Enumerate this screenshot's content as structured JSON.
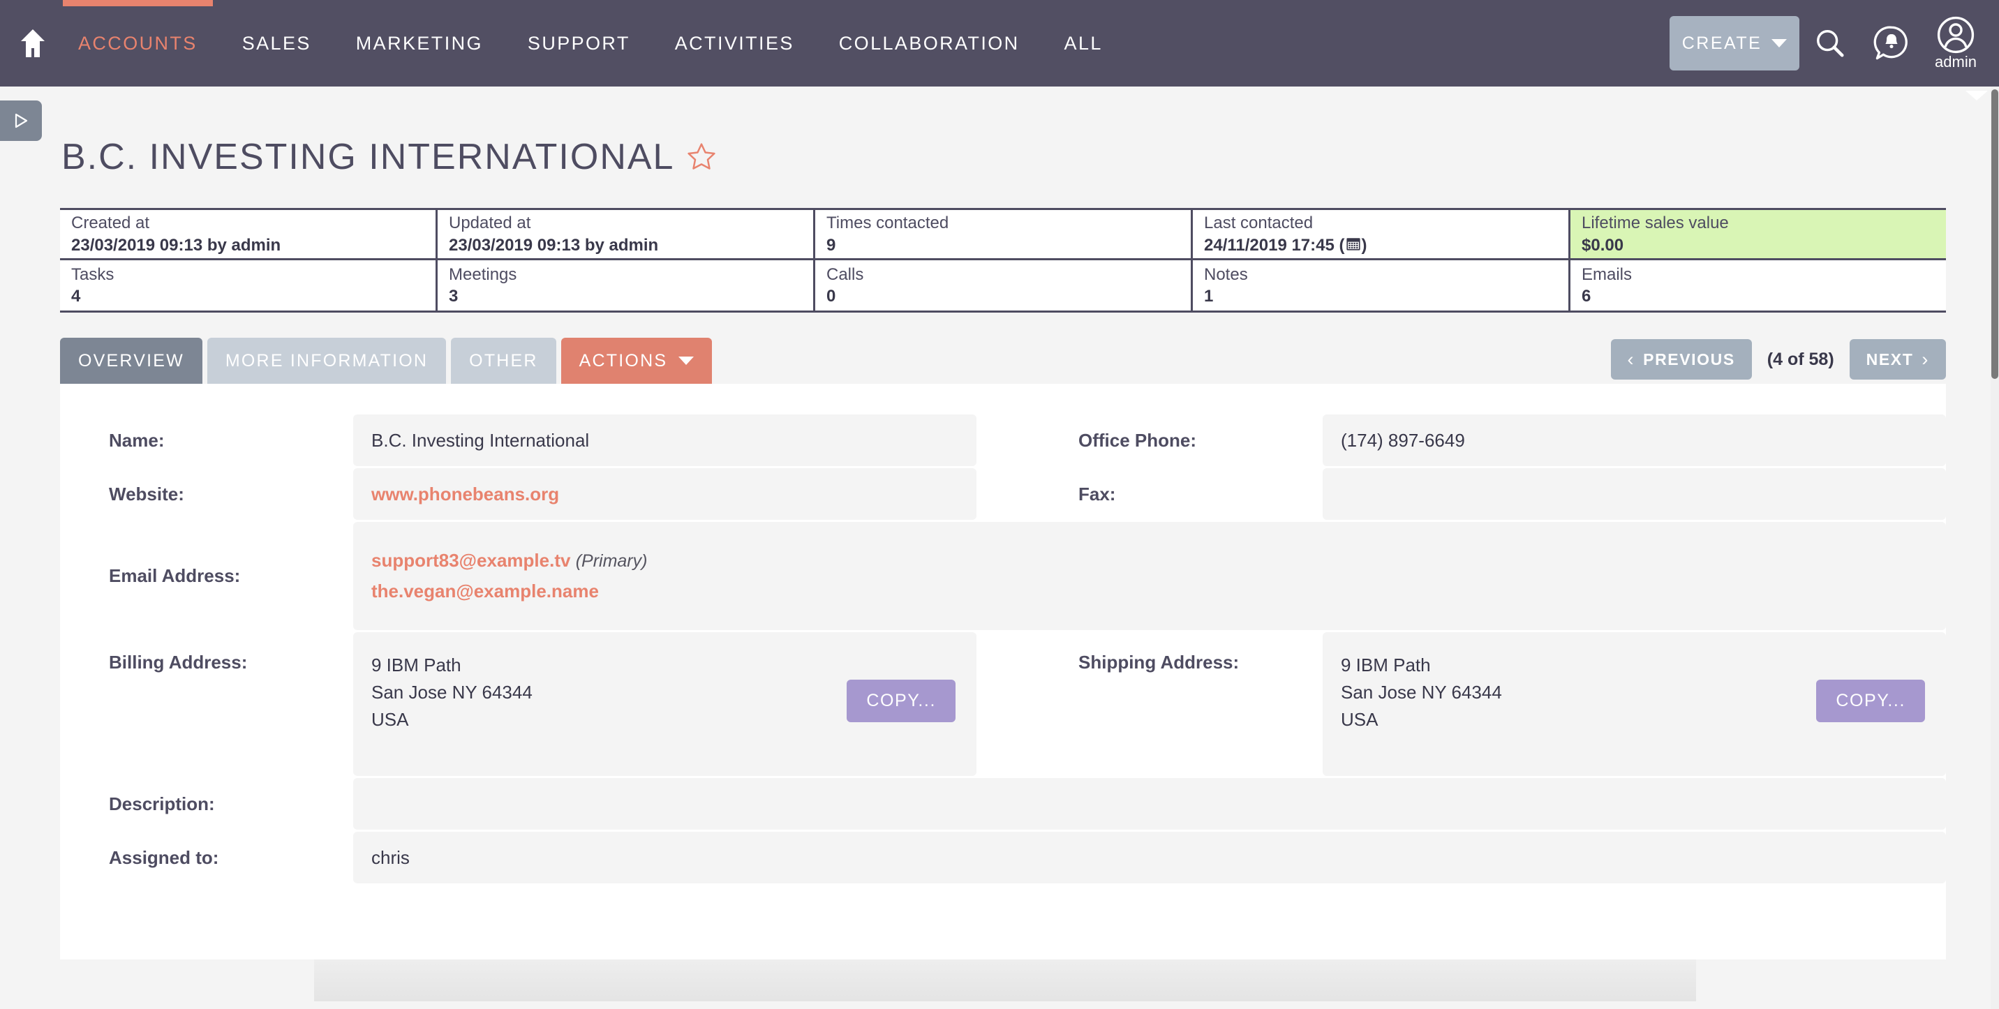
{
  "nav": {
    "home_icon": "home-icon",
    "items": [
      {
        "label": "ACCOUNTS",
        "active": true
      },
      {
        "label": "SALES",
        "active": false
      },
      {
        "label": "MARKETING",
        "active": false
      },
      {
        "label": "SUPPORT",
        "active": false
      },
      {
        "label": "ACTIVITIES",
        "active": false
      },
      {
        "label": "COLLABORATION",
        "active": false
      },
      {
        "label": "ALL",
        "active": false
      }
    ],
    "create_label": "CREATE",
    "search_icon": "search-icon",
    "notifications_icon": "notification-bell-icon",
    "avatar_icon": "user-avatar-icon",
    "user_name": "admin",
    "accent_color": "#e8836e",
    "bar_color": "#524f63"
  },
  "sidebar_toggle": {
    "icon": "expand-sidebar-icon"
  },
  "page": {
    "title": "B.C. INVESTING INTERNATIONAL",
    "favorite_icon": "star-outline-icon"
  },
  "info_table": {
    "row1": [
      {
        "label": "Created at",
        "value": "23/03/2019 09:13 by admin",
        "highlight": false
      },
      {
        "label": "Updated at",
        "value": "23/03/2019 09:13 by admin",
        "highlight": false
      },
      {
        "label": "Times contacted",
        "value": "9",
        "highlight": false
      },
      {
        "label": "Last contacted",
        "value": "24/11/2019 17:45 (",
        "value_suffix": ")",
        "icon": "calendar-icon",
        "highlight": false
      },
      {
        "label": "Lifetime sales value",
        "value": "$0.00",
        "highlight": true,
        "highlight_color": "#d9f5b5"
      }
    ],
    "row2": [
      {
        "label": "Tasks",
        "value": "4"
      },
      {
        "label": "Meetings",
        "value": "3"
      },
      {
        "label": "Calls",
        "value": "0"
      },
      {
        "label": "Notes",
        "value": "1"
      },
      {
        "label": "Emails",
        "value": "6"
      }
    ]
  },
  "tabs": [
    {
      "label": "OVERVIEW",
      "state": "selected"
    },
    {
      "label": "MORE INFORMATION",
      "state": "unselected"
    },
    {
      "label": "OTHER",
      "state": "unselected"
    },
    {
      "label": "ACTIONS",
      "state": "action",
      "has_caret": true
    }
  ],
  "pager": {
    "previous_label": "PREVIOUS",
    "next_label": "NEXT",
    "count_label": "(4 of 58)",
    "prev_chevron": "chevron-left-icon",
    "next_chevron": "chevron-right-icon"
  },
  "form": {
    "name": {
      "label": "Name:",
      "value": "B.C. Investing International"
    },
    "office_phone": {
      "label": "Office Phone:",
      "value": "(174) 897-6649"
    },
    "website": {
      "label": "Website:",
      "value": "www.phonebeans.org"
    },
    "fax": {
      "label": "Fax:",
      "value": ""
    },
    "email": {
      "label": "Email Address:",
      "primary": "support83@example.tv",
      "primary_tag": "(Primary)",
      "secondary": "the.vegan@example.name"
    },
    "billing_address": {
      "label": "Billing Address:",
      "line1": "9 IBM Path",
      "line2": "San Jose NY   64344",
      "line3": "USA",
      "copy_label": "COPY..."
    },
    "shipping_address": {
      "label": "Shipping Address:",
      "line1": "9 IBM Path",
      "line2": "San Jose NY   64344",
      "line3": "USA",
      "copy_label": "COPY..."
    },
    "description": {
      "label": "Description:",
      "value": ""
    },
    "assigned_to": {
      "label": "Assigned to:",
      "value": "chris"
    }
  }
}
